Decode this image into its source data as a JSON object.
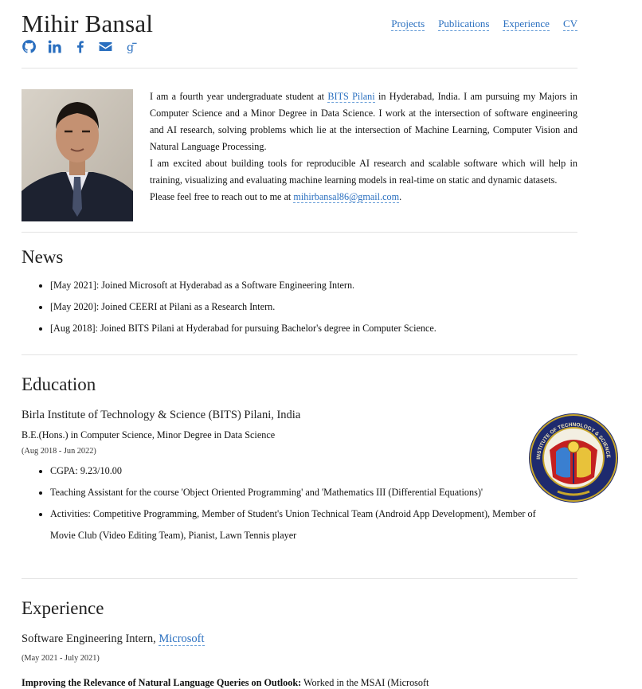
{
  "header": {
    "name": "Mihir Bansal",
    "nav": [
      "Projects",
      "Publications",
      "Experience",
      "CV"
    ],
    "social_icons": [
      "github-icon",
      "linkedin-icon",
      "facebook-icon",
      "envelope-icon",
      "google-scholar-icon"
    ]
  },
  "bio": {
    "p1_a": "I am a fourth year undergraduate student at ",
    "p1_link": "BITS Pilani",
    "p1_b": " in Hyderabad, India. I am pursuing my Majors in Computer Science and a Minor Degree in Data Science. I work at the intersection of software engineering and AI research, solving problems which lie at the intersection of Machine Learning, Computer Vision and Natural Language Processing.",
    "p2": "I am excited about building tools for reproducible AI research and scalable software which will help in training, visualizing and evaluating machine learning models in real-time on static and dynamic datasets.",
    "p3_a": "Please feel free to reach out to me at ",
    "p3_link": "mihirbansal86@gmail.com",
    "p3_b": "."
  },
  "news": {
    "title": "News",
    "items": [
      "[May 2021]: Joined Microsoft at Hyderabad as a Software Engineering Intern.",
      "[May 2020]: Joined CEERI at Pilani as a Research Intern.",
      "[Aug 2018]: Joined BITS Pilani at Hyderabad for pursuing Bachelor's degree in Computer Science."
    ]
  },
  "education": {
    "title": "Education",
    "institution": "Birla Institute of Technology & Science (BITS) Pilani, India",
    "degree": "B.E.(Hons.) in Computer Science, Minor Degree in Data Science",
    "dates": "(Aug 2018  -  Jun 2022)",
    "items": [
      "CGPA: 9.23/10.00",
      "Teaching Assistant for the course 'Object Oriented Programming' and 'Mathematics III (Differential Equations)'",
      "Activities: Competitive Programming, Member of Student's Union Technical Team (Android App Development), Member of Movie Club (Video Editing Team), Pianist, Lawn Tennis player"
    ],
    "logo_text": "BIRLA INSTITUTE OF TECHNOLOGY & SCIENCE PILANI"
  },
  "experience": {
    "title": "Experience",
    "role": "Software Engineering Intern, ",
    "company": "Microsoft",
    "dates": "(May 2021  -  July 2021)",
    "project_title": "Improving the Relevance of Natural Language Queries on Outlook:",
    "project_text": " Worked in the MSAI (Microsoft"
  }
}
